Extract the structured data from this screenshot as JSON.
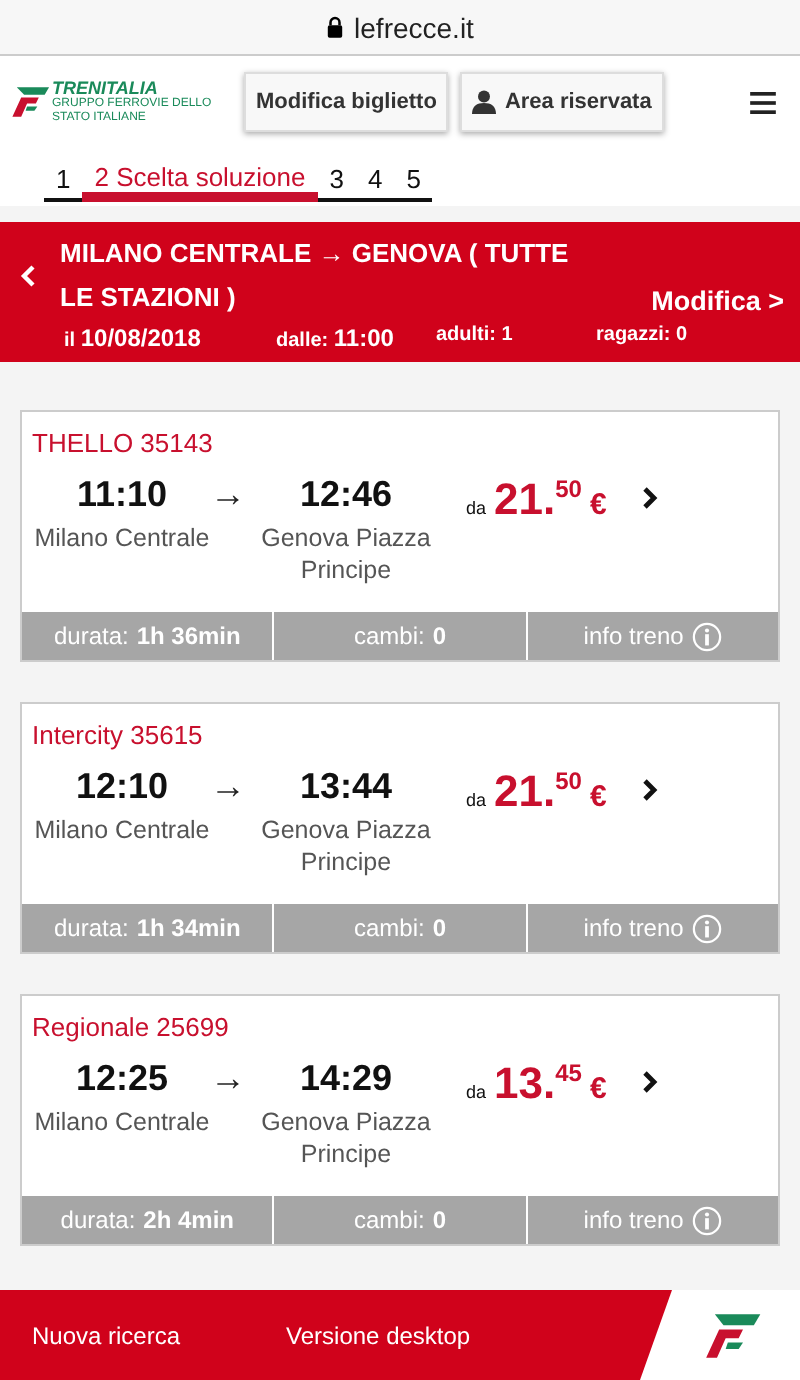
{
  "browser": {
    "url": "lefrecce.it"
  },
  "header": {
    "brand": "TRENITALIA",
    "brand_subtitle": "GRUPPO FERROVIE DELLO STATO ITALIANE",
    "buttons": [
      {
        "label": "Modifica biglietto",
        "kind": "plain"
      },
      {
        "label": "Area riservata",
        "kind": "user"
      }
    ]
  },
  "steps": [
    {
      "label": "1",
      "selected": false
    },
    {
      "label": "2 Scelta soluzione",
      "selected": true
    },
    {
      "label": "3",
      "selected": false
    },
    {
      "label": "4",
      "selected": false
    },
    {
      "label": "5",
      "selected": false
    }
  ],
  "search": {
    "route": "MILANO CENTRALE → GENOVA ( TUTTE LE STAZIONI )",
    "edit": "Modifica >",
    "date": "il **10/08/2018**",
    "time": "dalle: **11:00**",
    "adults": "adulti: 1",
    "children": "ragazzi: 0"
  },
  "solutions": [
    {
      "train": "THELLO 35143",
      "departure": "11:10",
      "arrow": "→",
      "arrival": "12:46",
      "from": "Milano Centrale",
      "to": "Genova Piazza Principe",
      "price_prefix": "da",
      "price": "21.$^{50}$",
      "currency": "€",
      "duration": "durata: **1h 36min**",
      "changes": "cambi: **0**",
      "info": "info treno"
    },
    {
      "train": "Intercity 35615",
      "departure": "12:10",
      "arrow": "→",
      "arrival": "13:44",
      "from": "Milano Centrale",
      "to": "Genova Piazza Principe",
      "price_prefix": "da",
      "price": "21.$^{50}$",
      "currency": "€",
      "duration": "durata: **1h 34min**",
      "changes": "cambi: **0**",
      "info": "info treno"
    },
    {
      "train": "Regionale 25699",
      "departure": "12:25",
      "arrow": "→",
      "arrival": "14:29",
      "from": "Milano Centrale",
      "to": "Genova Piazza Principe",
      "price_prefix": "da",
      "price": "13.$^{45}$",
      "currency": "€",
      "duration": "durata: **2h 4min**",
      "changes": "cambi: **0**",
      "info": "info treno"
    }
  ],
  "footer": {
    "links": [
      "Nuova ricerca",
      "Versione desktop"
    ]
  }
}
